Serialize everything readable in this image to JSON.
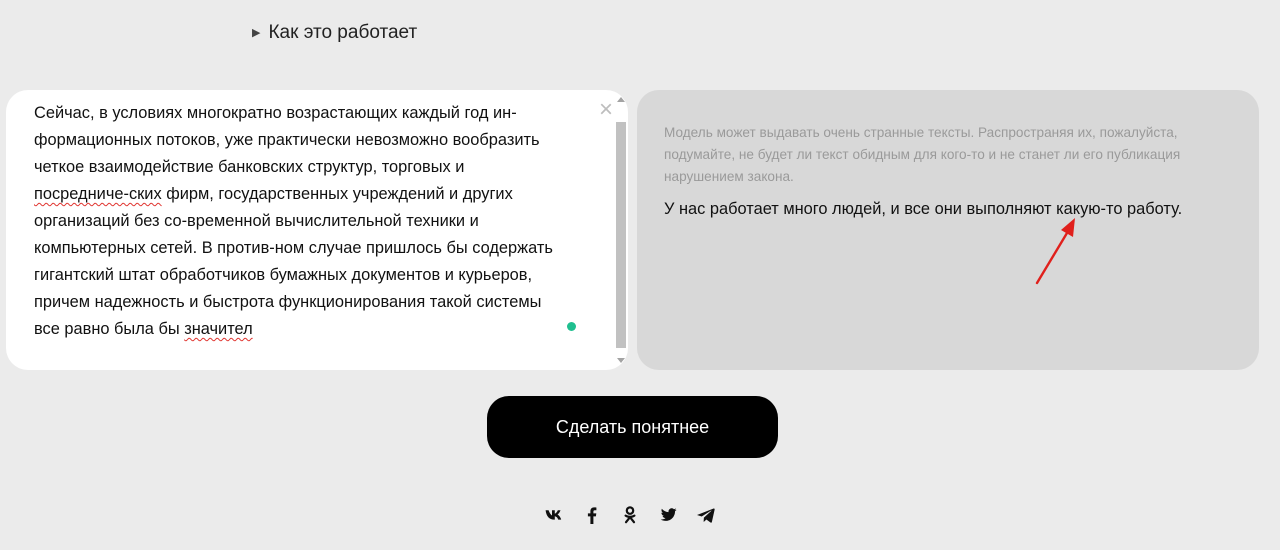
{
  "how_it_works": {
    "label": "Как это работает"
  },
  "input": {
    "lines": [
      {
        "text": "Сейчас, в условиях многократно возрастающих каждый год ин-"
      },
      {
        "text": "формационных потоков,  уже практически  невозможно  вообразить"
      },
      {
        "text": "четкое взаимодействие банковских структур,  торговых и"
      },
      {
        "pre": "",
        "spell": "посредниче-ских",
        "post": " фирм, государственных учреждений и других"
      },
      {
        "text": "организаций без со-временной вычислительной техники и"
      },
      {
        "text": "компьютерных сетей. В против-ном случае пришлось бы содержать"
      },
      {
        "text": "гигантский  штат  обработчиков бумажных документов и курьеров,"
      },
      {
        "text": "причем надежность и быстрота функционирования такой системы"
      },
      {
        "pre": "все равно была бы ",
        "spell": "значител",
        "post": ""
      }
    ],
    "clear_icon": "×"
  },
  "output": {
    "disclaimer_lines": [
      "Модель может выдавать очень странные тексты. Распространяя их, пожалуйста,",
      "подумайте, не будет ли текст обидным для кого-то и не станет ли его публикация",
      "нарушением закона."
    ],
    "result": "У нас работает много людей, и все они выполняют какую-то работу."
  },
  "submit": {
    "label": "Сделать понятнее"
  },
  "share": {
    "icons": [
      "vk-icon",
      "facebook-icon",
      "odnoklassniki-icon",
      "twitter-icon",
      "telegram-icon"
    ]
  },
  "colors": {
    "page_bg": "#ebebeb",
    "input_bg": "#ffffff",
    "output_bg": "#d8d8d8",
    "button_bg": "#000000",
    "status_dot": "#1fbf8f",
    "annotation": "#e0201c"
  }
}
